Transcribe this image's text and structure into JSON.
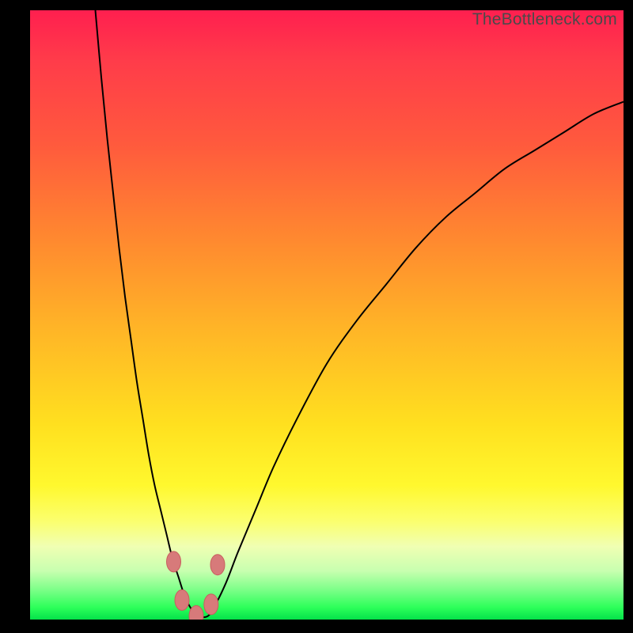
{
  "watermark": "TheBottleneck.com",
  "colors": {
    "curve": "#000000",
    "marker_fill": "#d77a7a",
    "marker_stroke": "#c95e5e",
    "frame": "#000000"
  },
  "chart_data": {
    "type": "line",
    "title": "",
    "xlabel": "",
    "ylabel": "",
    "xlim": [
      0,
      100
    ],
    "ylim": [
      0,
      100
    ],
    "grid": false,
    "legend": false,
    "x": [
      11,
      12,
      13,
      14,
      15,
      16,
      17,
      18,
      19,
      20,
      21,
      22,
      23,
      24,
      25,
      26,
      27,
      28,
      29,
      30,
      31,
      33,
      35,
      38,
      41,
      45,
      50,
      55,
      60,
      65,
      70,
      75,
      80,
      85,
      90,
      95,
      100
    ],
    "values": [
      100,
      89,
      79,
      70,
      61,
      53,
      46,
      39,
      33,
      27,
      22,
      18,
      14,
      10,
      7,
      4,
      2,
      0.8,
      0.4,
      0.6,
      2,
      6,
      11,
      18,
      25,
      33,
      42,
      49,
      55,
      61,
      66,
      70,
      74,
      77,
      80,
      83,
      85
    ],
    "markers": [
      {
        "x": 24.2,
        "y": 9.5
      },
      {
        "x": 25.6,
        "y": 3.2
      },
      {
        "x": 28.0,
        "y": 0.6
      },
      {
        "x": 30.5,
        "y": 2.5
      },
      {
        "x": 31.6,
        "y": 9.0
      }
    ],
    "gradient_stops": [
      {
        "pos": 0,
        "color": "#ff1f4f"
      },
      {
        "pos": 50,
        "color": "#ffd024"
      },
      {
        "pos": 85,
        "color": "#fcff6a"
      },
      {
        "pos": 100,
        "color": "#04e24a"
      }
    ]
  }
}
